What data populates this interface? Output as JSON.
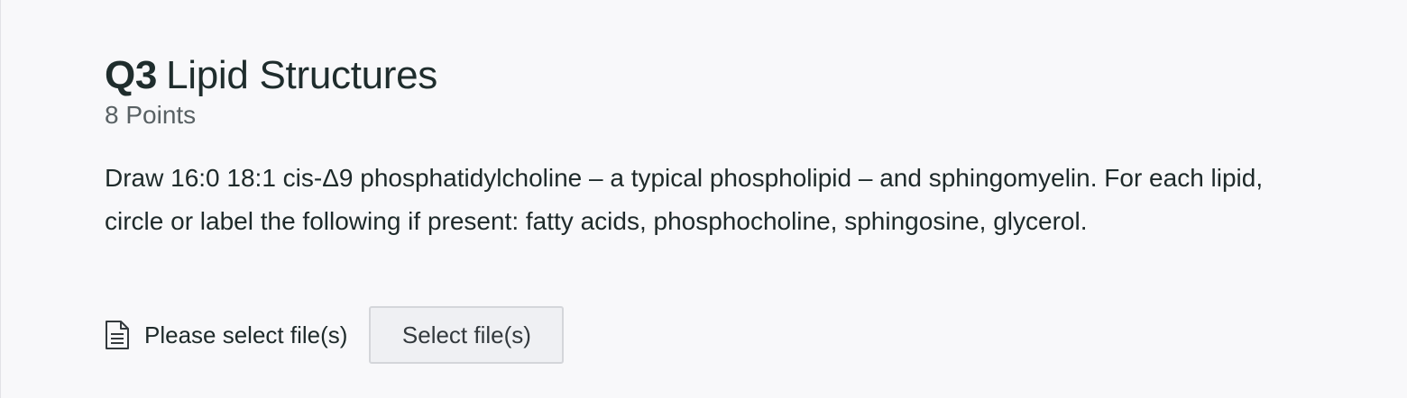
{
  "question": {
    "number": "Q3",
    "title": "Lipid Structures",
    "points": "8 Points",
    "prompt": "Draw 16:0 18:1 cis-Δ9 phosphatidylcholine – a typical phospholipid – and sphingomyelin.  For each lipid, circle or label the following if present: fatty acids, phosphocholine, sphingosine, glycerol."
  },
  "upload": {
    "icon": "file-document-icon",
    "status_text": "Please select file(s)",
    "button_label": "Select file(s)"
  },
  "colors": {
    "background": "#f8f8fa",
    "text": "#1e2a2a",
    "muted_text": "#596164",
    "button_bg": "#eff0f3",
    "button_border": "#d4d6da"
  }
}
